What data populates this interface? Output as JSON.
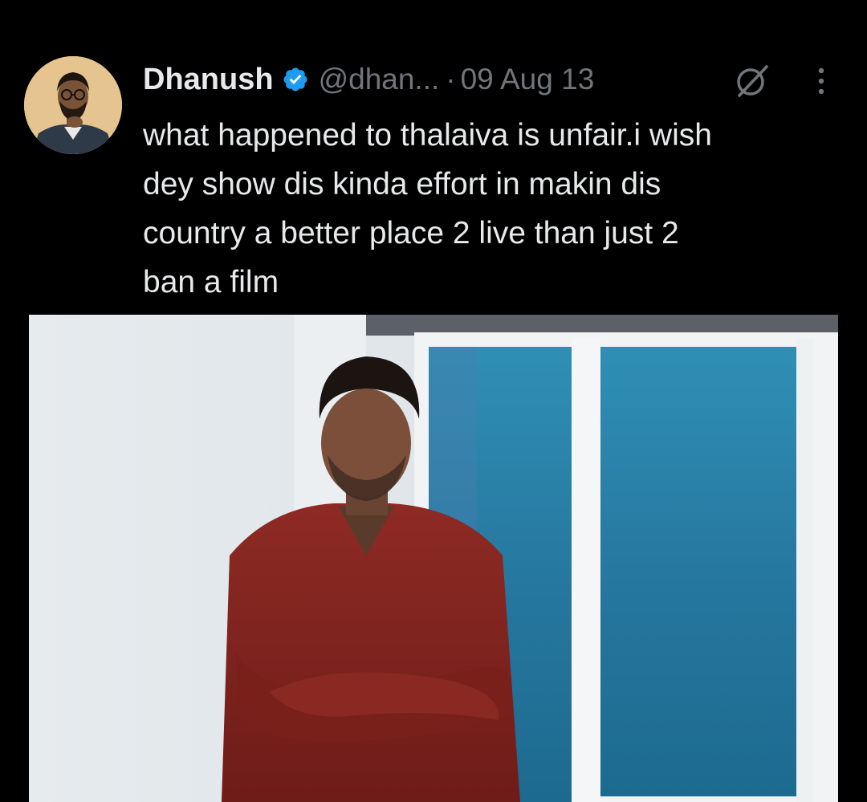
{
  "tweet": {
    "author_name": "Dhanush",
    "handle": "@dhan...",
    "separator": "·",
    "date": "09 Aug 13",
    "text_lines": [
      "what happened to thalaiva is unfair.i wish",
      "dey show dis kinda effort in makin dis",
      "country a better place 2 live than just 2",
      "ban a film"
    ]
  },
  "icons": {
    "verified": "verified-badge-icon",
    "grok": "grok-icon",
    "more": "more-options-icon"
  },
  "colors": {
    "background": "#000000",
    "text": "#e7e9ea",
    "secondary_text": "#71767b",
    "verified_blue": "#1d9bf0"
  }
}
